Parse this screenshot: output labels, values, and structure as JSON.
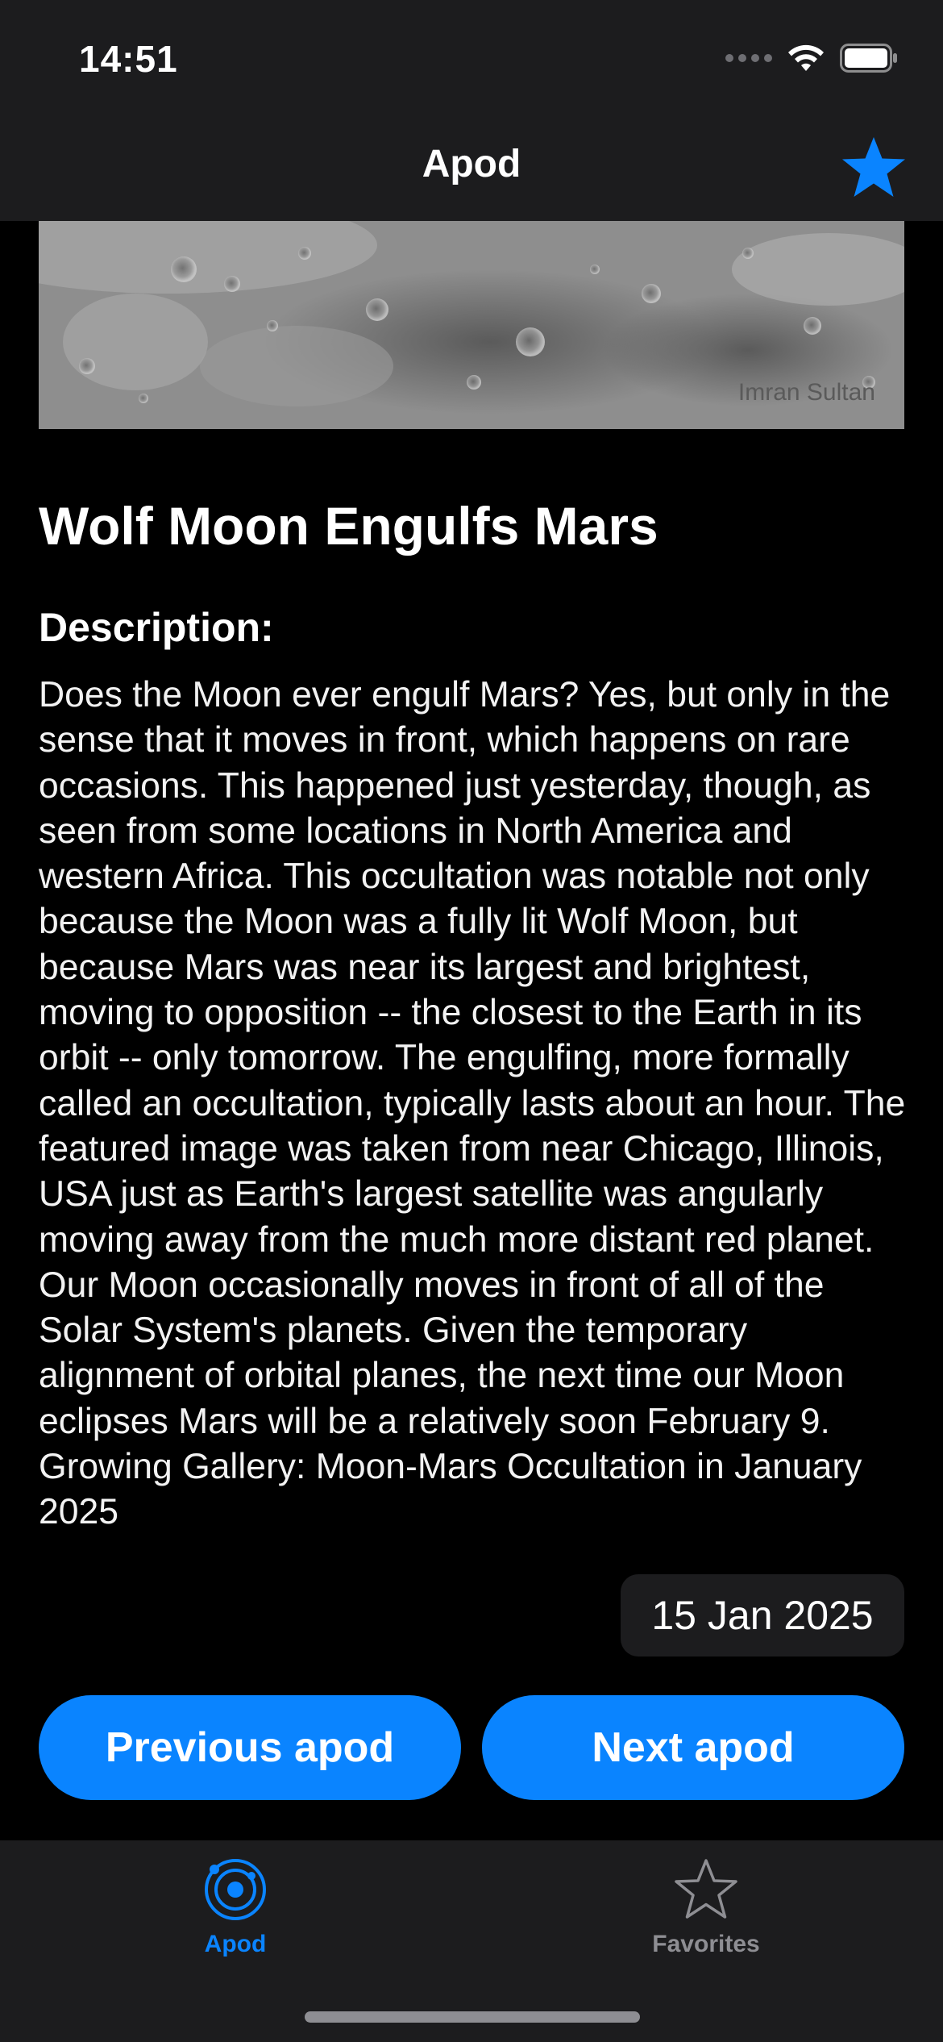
{
  "status_bar": {
    "time": "14:51"
  },
  "nav": {
    "title": "Apod",
    "favorite_icon": "star-filled-icon"
  },
  "apod": {
    "image_credit": "Imran Sultan",
    "title": "Wolf Moon Engulfs Mars",
    "description_label": "Description:",
    "description": "Does the Moon ever engulf Mars? Yes, but only in the sense that it moves in front, which happens on rare occasions.  This happened just yesterday, though, as seen from some locations in North America and western Africa.  This occultation was notable not only because the Moon was a fully lit Wolf Moon, but because Mars was near its largest and brightest, moving to opposition -- the closest to the Earth in its orbit -- only tomorrow.  The engulfing, more formally called an occultation, typically lasts about an hour. The featured image was taken from near Chicago, Illinois, USA just as Earth's largest satellite was angularly moving away from the much more distant red planet. Our  Moon occasionally moves in front of all of the Solar System's planets.  Given the temporary alignment of orbital planes, the next time our Moon eclipses Mars will be a relatively soon February 9.   Growing Gallery: Moon-Mars Occultation in January 2025",
    "date": "15 Jan 2025"
  },
  "buttons": {
    "previous": "Previous apod",
    "next": "Next apod"
  },
  "tabs": [
    {
      "label": "Apod",
      "icon": "orbit-icon",
      "active": true
    },
    {
      "label": "Favorites",
      "icon": "star-outline-icon",
      "active": false
    }
  ],
  "colors": {
    "accent": "#0a84ff",
    "background": "#000000",
    "bar": "#1c1c1e",
    "inactive": "#8e8e93"
  }
}
